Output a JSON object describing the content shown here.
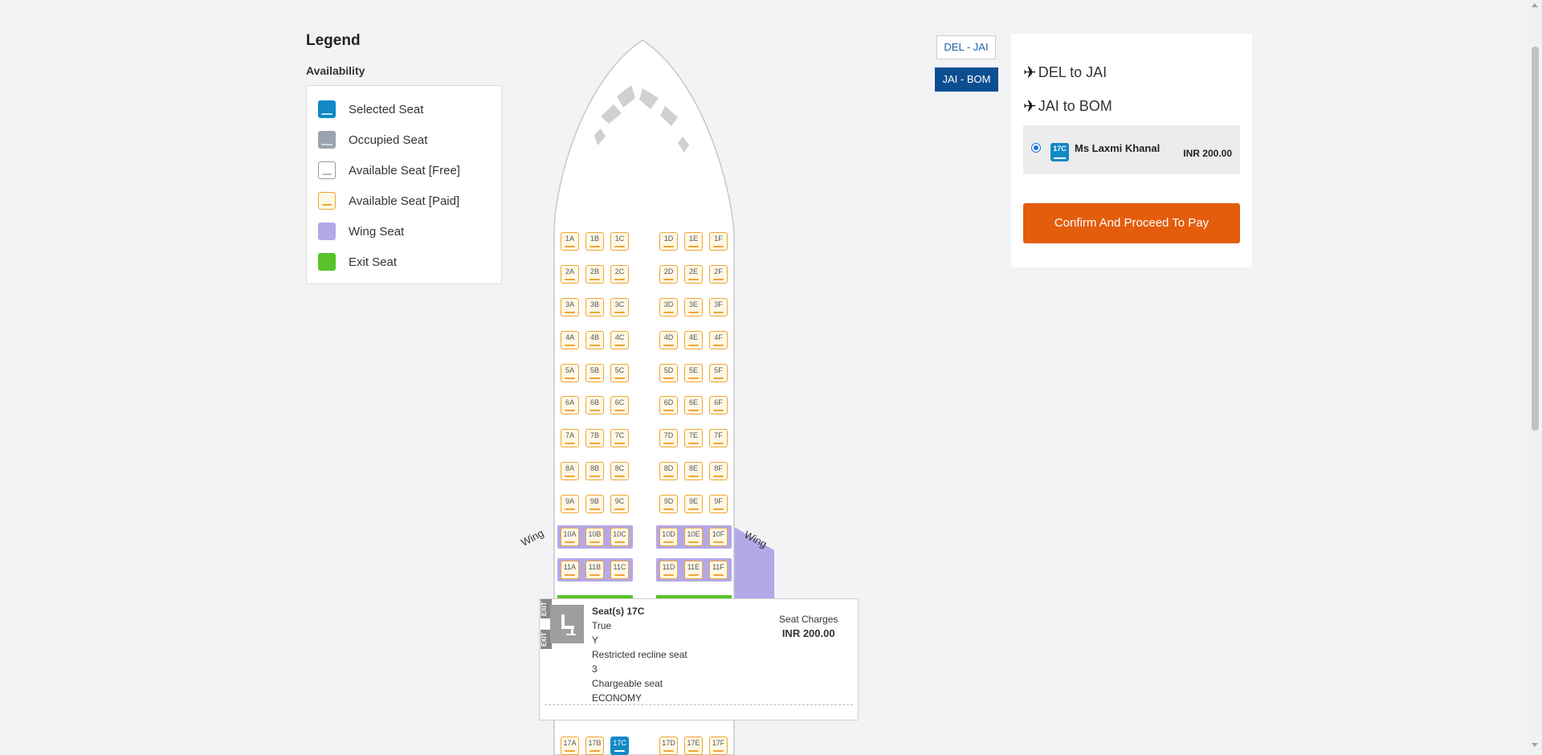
{
  "legend": {
    "title": "Legend",
    "subtitle": "Availability",
    "items": [
      {
        "label": "Selected Seat",
        "type": "selected"
      },
      {
        "label": "Occupied Seat",
        "type": "occupied"
      },
      {
        "label": "Available Seat [Free]",
        "type": "free"
      },
      {
        "label": "Available Seat [Paid]",
        "type": "paid"
      },
      {
        "label": "Wing Seat",
        "type": "wing"
      },
      {
        "label": "Exit Seat",
        "type": "exit"
      }
    ]
  },
  "seatmap": {
    "wing_label": "Wing",
    "exit_label": "EXIT",
    "rows": [
      "1",
      "2",
      "3",
      "4",
      "5",
      "6",
      "7",
      "8",
      "9",
      "10",
      "11",
      "17"
    ],
    "columns_left": [
      "A",
      "B",
      "C"
    ],
    "columns_right": [
      "D",
      "E",
      "F"
    ],
    "wing_rows": [
      "10",
      "11"
    ],
    "selected_seat": "17C"
  },
  "tooltip": {
    "title": "Seat(s) 17C",
    "lines": [
      "True",
      "Y",
      "Restricted recline seat",
      "3",
      "Chargeable seat",
      "ECONOMY"
    ],
    "charges_label": "Seat Charges",
    "charges_amount": "INR 200.00",
    "thumb_icon": "seat-icon"
  },
  "sectors": {
    "tabs": [
      {
        "label": "DEL - JAI",
        "active": false
      },
      {
        "label": "JAI - BOM",
        "active": true
      }
    ]
  },
  "summary": {
    "routes": [
      {
        "label": "DEL to JAI",
        "icon": "plane-icon"
      },
      {
        "label": "JAI to BOM",
        "icon": "plane-icon"
      }
    ],
    "passenger": {
      "seat": "17C",
      "name": "Ms Laxmi Khanal",
      "price": "INR 200.00"
    },
    "confirm_label": "Confirm And Proceed To Pay"
  },
  "colors": {
    "selected": "#1189c6",
    "paid_border": "#f0a531",
    "wing": "#b3a8e8",
    "exit": "#58c32a",
    "confirm": "#e35d0d",
    "active_tab": "#0c4f91"
  }
}
